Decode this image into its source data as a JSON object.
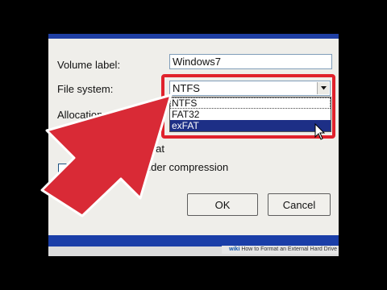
{
  "dialog": {
    "volume_label_label": "Volume label:",
    "volume_label_value": "Windows7",
    "file_system_label": "File system:",
    "file_system_value": "NTFS",
    "file_system_options": [
      "NTFS",
      "FAT32",
      "exFAT"
    ],
    "allocation_label": "Allocation u",
    "quick_format_label": "rmat",
    "compression_label": "older compression",
    "ok_label": "OK",
    "cancel_label": "Cancel"
  },
  "caption": {
    "brand": "wiki",
    "text": "How to Format an External Hard Drive"
  },
  "colors": {
    "highlight": "#e0222c",
    "arrow": "#d92a36",
    "selected_option": "#1d2f86"
  },
  "icons": [
    "chevron-down-icon",
    "pointer-cursor-icon",
    "big-red-arrow-icon"
  ]
}
